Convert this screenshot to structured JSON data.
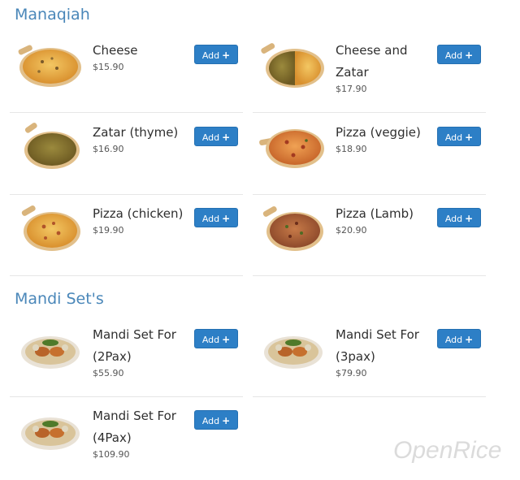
{
  "sections": [
    {
      "title": "Manaqiah",
      "items": [
        {
          "name": "Cheese",
          "price": "$15.90",
          "add_label": "Add",
          "image": "pizza-cheese-icon"
        },
        {
          "name": "Cheese and Zatar",
          "price": "$17.90",
          "add_label": "Add",
          "image": "pizza-cheese-zatar-icon"
        },
        {
          "name": "Zatar (thyme)",
          "price": "$16.90",
          "add_label": "Add",
          "image": "pizza-zatar-icon"
        },
        {
          "name": "Pizza (veggie)",
          "price": "$18.90",
          "add_label": "Add",
          "image": "pizza-veggie-icon"
        },
        {
          "name": "Pizza (chicken)",
          "price": "$19.90",
          "add_label": "Add",
          "image": "pizza-chicken-icon"
        },
        {
          "name": "Pizza (Lamb)",
          "price": "$20.90",
          "add_label": "Add",
          "image": "pizza-lamb-icon"
        }
      ]
    },
    {
      "title": "Mandi Set's",
      "items": [
        {
          "name": "Mandi Set For (2Pax)",
          "price": "$55.90",
          "add_label": "Add",
          "image": "mandi-platter-icon"
        },
        {
          "name": "Mandi Set For (3pax)",
          "price": "$79.90",
          "add_label": "Add",
          "image": "mandi-platter-icon"
        },
        {
          "name": "Mandi Set For (4Pax)",
          "price": "$109.90",
          "add_label": "Add",
          "image": "mandi-platter-icon"
        }
      ]
    }
  ],
  "add_icon": "+",
  "watermark": "OpenRice",
  "colors": {
    "section_title": "#4a87b9",
    "button": "#2d7fc6",
    "divider": "#e6e6e6"
  }
}
